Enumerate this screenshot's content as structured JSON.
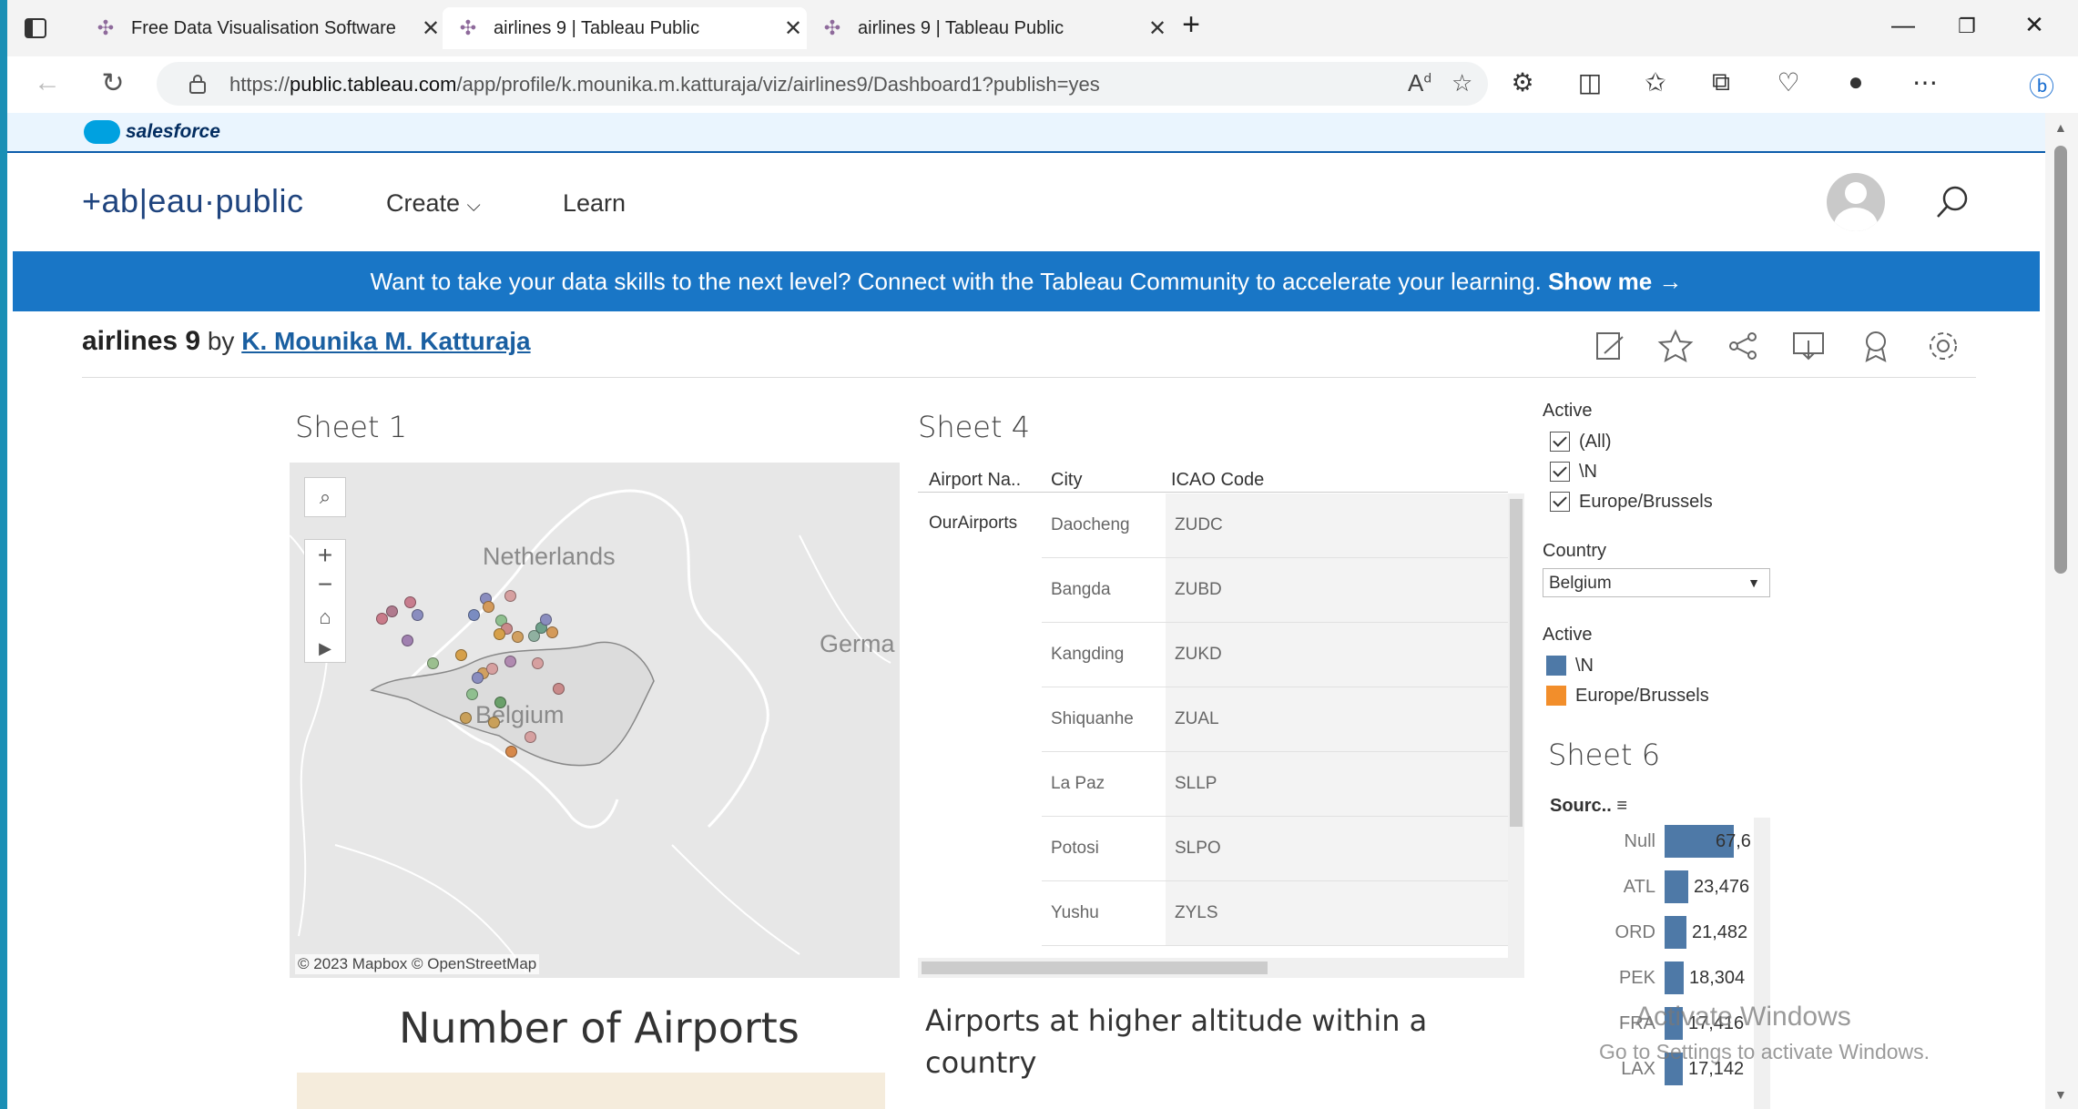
{
  "browser": {
    "tabs": [
      {
        "label": "Free Data Visualisation Software",
        "active": false
      },
      {
        "label": "airlines 9 | Tableau Public",
        "active": true
      },
      {
        "label": "airlines 9 | Tableau Public",
        "active": false
      }
    ],
    "url_prefix": "https://",
    "url_domain": "public.tableau.com",
    "url_path": "/app/profile/k.mounika.m.katturaja/viz/airlines9/Dashboard1?publish=yes"
  },
  "salesforce": {
    "label": "salesforce"
  },
  "header": {
    "logo": "+ab|eau·public",
    "nav": [
      {
        "label": "Create"
      },
      {
        "label": "Learn"
      }
    ]
  },
  "banner": {
    "text": "Want to take your data skills to the next level? Connect with the Tableau Community to accelerate your learning.",
    "cta": "Show me →"
  },
  "viz": {
    "title": "airlines 9",
    "by": "by",
    "author": "K. Mounika M. Katturaja"
  },
  "sheet1": {
    "title": "Sheet 1",
    "labels": {
      "netherlands": "Netherlands",
      "belgium": "Belgium",
      "germany": "Germa"
    },
    "copyright": "© 2023 Mapbox  © OpenStreetMap"
  },
  "sheet4": {
    "title": "Sheet 4",
    "columns": [
      "Airport Na..",
      "City",
      "ICAO Code"
    ],
    "group": "OurAirports",
    "rows": [
      {
        "city": "Daocheng",
        "icao": "ZUDC"
      },
      {
        "city": "Bangda",
        "icao": "ZUBD"
      },
      {
        "city": "Kangding",
        "icao": "ZUKD"
      },
      {
        "city": "Shiquanhe",
        "icao": "ZUAL"
      },
      {
        "city": "La Paz",
        "icao": "SLLP"
      },
      {
        "city": "Potosi",
        "icao": "SLPO"
      },
      {
        "city": "Yushu",
        "icao": "ZYLS"
      }
    ]
  },
  "filters": {
    "active_title": "Active",
    "active_items": [
      "(All)",
      "\\N",
      "Europe/Brussels"
    ],
    "country_title": "Country",
    "country_value": "Belgium",
    "legend_title": "Active",
    "legend_items": [
      {
        "label": "\\N",
        "color": "#4e79a7"
      },
      {
        "label": "Europe/Brussels",
        "color": "#f28e2b"
      }
    ]
  },
  "sheet6": {
    "title": "Sheet 6",
    "header": "Sourc.."
  },
  "chart_data": {
    "type": "bar",
    "categories": [
      "Null",
      "ATL",
      "ORD",
      "PEK",
      "FRA",
      "LAX"
    ],
    "values": [
      67600,
      23476,
      21482,
      18304,
      17416,
      17142
    ],
    "labels": [
      "67,6",
      "23,476",
      "21,482",
      "18,304",
      "17,416",
      "17,142"
    ],
    "color": "#4e79a7"
  },
  "panels": {
    "number_of_airports": "Number of Airports",
    "altitude_title": "Airports at higher altitude within a country"
  },
  "watermark": {
    "line1": "Activate Windows",
    "line2": "Go to Settings to activate Windows."
  }
}
